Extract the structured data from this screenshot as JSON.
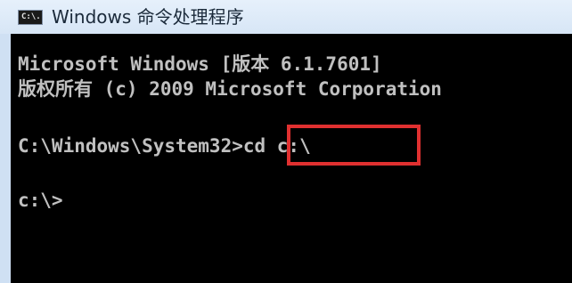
{
  "window": {
    "title": "Windows 命令处理程序",
    "icon_name": "cmd-icon",
    "icon_text": "C:\\."
  },
  "console": {
    "lines": [
      "Microsoft Windows [版本 6.1.7601]",
      "版权所有 (c) 2009 Microsoft Corporation",
      "C:\\Windows\\System32>cd c:\\",
      "c:\\>"
    ],
    "text_color": "#c0c0c0",
    "background": "#000000"
  },
  "annotation": {
    "highlight_color": "#e03030"
  }
}
